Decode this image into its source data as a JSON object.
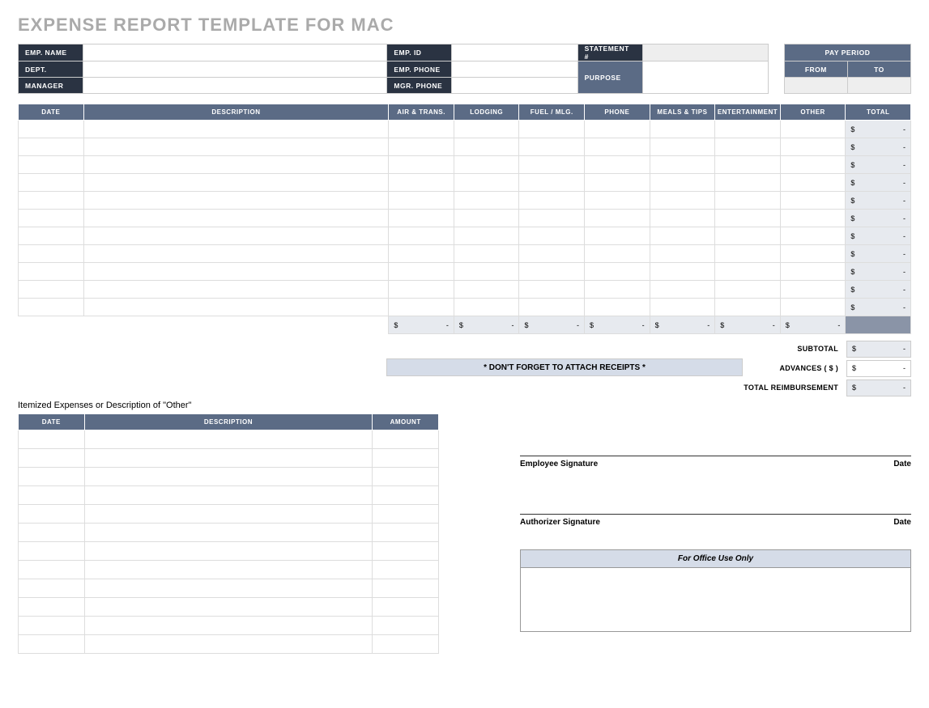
{
  "title": "EXPENSE REPORT TEMPLATE FOR MAC",
  "info": {
    "emp_name_lbl": "EMP. NAME",
    "emp_id_lbl": "EMP. ID",
    "statement_lbl": "STATEMENT #",
    "pay_period_lbl": "PAY PERIOD",
    "dept_lbl": "DEPT.",
    "emp_phone_lbl": "EMP. PHONE",
    "purpose_lbl": "PURPOSE",
    "from_lbl": "FROM",
    "to_lbl": "TO",
    "manager_lbl": "MANAGER",
    "mgr_phone_lbl": "MGR. PHONE",
    "emp_name": "",
    "emp_id": "",
    "statement": "",
    "dept": "",
    "emp_phone": "",
    "purpose": "",
    "from": "",
    "to": "",
    "manager": "",
    "mgr_phone": ""
  },
  "exp": {
    "headers": {
      "date": "DATE",
      "desc": "DESCRIPTION",
      "air": "AIR & TRANS.",
      "lodging": "LODGING",
      "fuel": "FUEL / MLG.",
      "phone": "PHONE",
      "meals": "MEALS & TIPS",
      "ent": "ENTERTAINMENT",
      "other": "OTHER",
      "total": "TOTAL"
    },
    "cur": "$",
    "dash": "-",
    "rows": 11
  },
  "banner": "* DON'T FORGET TO ATTACH RECEIPTS *",
  "summary": {
    "subtotal_lbl": "SUBTOTAL",
    "advances_lbl": "ADVANCES  ( $ )",
    "total_lbl": "TOTAL REIMBURSEMENT",
    "cur": "$",
    "dash": "-"
  },
  "itemized": {
    "caption": "Itemized Expenses or Description of \"Other\"",
    "headers": {
      "date": "DATE",
      "desc": "DESCRIPTION",
      "amount": "AMOUNT"
    },
    "rows": 12
  },
  "sig": {
    "emp": "Employee Signature",
    "auth": "Authorizer Signature",
    "date": "Date",
    "office": "For Office Use Only"
  }
}
